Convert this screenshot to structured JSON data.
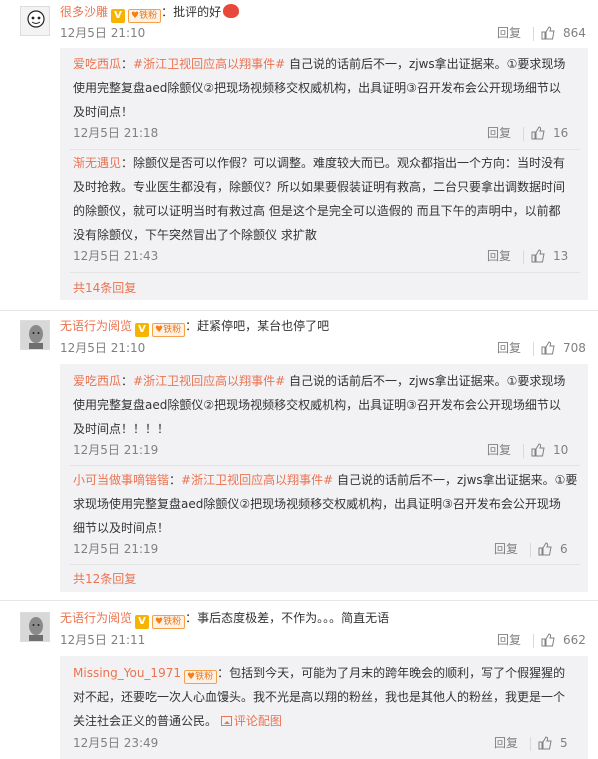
{
  "badge_v": "V",
  "badge_fan_label": "铁粉",
  "reply_label": "回复",
  "comment1": {
    "avatar_caption": "很多沙雕",
    "user": "很多沙雕",
    "sep": "：",
    "text": "批评的好",
    "time": "12月5日 21:10",
    "likes": "864",
    "replies": [
      {
        "user": "爱吃西瓜",
        "sep": "：",
        "topic": "#浙江卫视回应高以翔事件#",
        "line1": " 自己说的话前后不一，zjws拿出证据来。①要求现场",
        "line2": "使用完整复盘aed除颤仪②把现场视频移交权威机构，出具证明③召开发布会公开现场细节以",
        "line3": "及时间点！",
        "time": "12月5日 21:18",
        "likes": "16"
      },
      {
        "user": "渐无遇见",
        "sep": "：",
        "line1": "除颤仪是否可以作假？可以调整。难度较大而已。观众都指出一个方向：当时没有",
        "line2": "及时抢救。专业医生都没有，除颤仪？所以如果要假装证明有救高，二台只要拿出调数据时间",
        "line3": "的除颤仪，就可以证明当时有救过高 但是这个是完全可以造假的 而且下午的声明中，以前都",
        "line4": "没有除颤仪，下午突然冒出了个除颤仪 求扩散",
        "time": "12月5日 21:43",
        "likes": "13"
      }
    ],
    "more": "共14条回复"
  },
  "comment2": {
    "user": "无语行为阅览",
    "sep": "：",
    "text": "赶紧停吧，某台也停了吧",
    "time": "12月5日 21:10",
    "likes": "708",
    "replies": [
      {
        "user": "爱吃西瓜",
        "sep": "：",
        "topic": "#浙江卫视回应高以翔事件#",
        "line1": " 自己说的话前后不一，zjws拿出证据来。①要求现场",
        "line2": "使用完整复盘aed除颤仪②把现场视频移交权威机构，出具证明③召开发布会公开现场细节以",
        "line3": "及时间点！！！！",
        "time": "12月5日 21:19",
        "likes": "10"
      },
      {
        "user": "小可当做事嘀锴锴",
        "sep": "：",
        "topic": "#浙江卫视回应高以翔事件#",
        "line1": " 自己说的话前后不一，zjws拿出证据来。①要",
        "line2": "求现场使用完整复盘aed除颤仪②把现场视频移交权威机构，出具证明③召开发布会公开现场",
        "line3": "细节以及时间点！",
        "time": "12月5日 21:19",
        "likes": "6"
      }
    ],
    "more": "共12条回复"
  },
  "comment3": {
    "user": "无语行为阅览",
    "sep": "：",
    "text": "事后态度极差，不作为。。。简直无语",
    "time": "12月5日 21:11",
    "likes": "662",
    "replies": [
      {
        "user": "Missing_You_1971",
        "sep": "：",
        "line1": "包括到今天，可能为了月末的跨年晚会的顺利，写了个假猩猩的",
        "line2": "对不起，还要吃一次人心血馒头。我不光是高以翔的粉丝，我也是其他人的粉丝，我更是一个",
        "line3": "关注社会正义的普通公民。",
        "pic_link": "评论配图",
        "time": "12月5日 23:49",
        "likes": "5"
      }
    ]
  },
  "colors": {
    "accent": "#eb7350",
    "muted": "#808080",
    "subbg": "#f2f2f5"
  },
  "icons": [
    "thumb-up-icon",
    "v-badge-icon",
    "fan-badge-icon",
    "picture-icon",
    "emoji-icon",
    "avatar-icon"
  ]
}
